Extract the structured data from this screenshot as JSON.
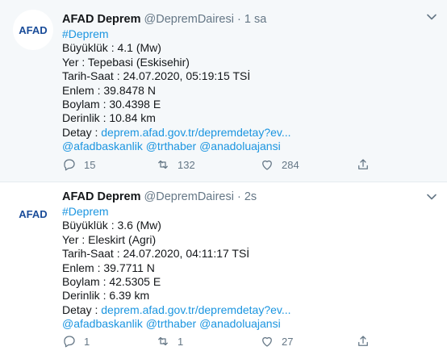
{
  "tweets": [
    {
      "logo_main": "AFAD",
      "author": "AFAD Deprem",
      "handle": "@DepremDairesi",
      "separator": "·",
      "time": "1 sa",
      "hashtag": "#Deprem",
      "magnitude": "Büyüklük : 4.1 (Mw)",
      "place": "Yer : Tepebasi (Eskisehir)",
      "datetime": "Tarih-Saat : 24.07.2020, 05:19:15 TSİ",
      "lat": "Enlem : 39.8478 N",
      "lon": "Boylam : 30.4398 E",
      "depth": "Derinlik : 10.84 km",
      "detail_label": "Detay : ",
      "detail_link": "deprem.afad.gov.tr/depremdetay?ev...",
      "mentions": [
        "@afadbaskanlik",
        "@trthaber",
        "@anadoluajansi"
      ],
      "replies": "15",
      "retweets": "132",
      "likes": "284"
    },
    {
      "logo_main": "AFAD",
      "author": "AFAD Deprem",
      "handle": "@DepremDairesi",
      "separator": "·",
      "time": "2s",
      "hashtag": "#Deprem",
      "magnitude": "Büyüklük : 3.6 (Mw)",
      "place": "Yer : Eleskirt (Agri)",
      "datetime": "Tarih-Saat : 24.07.2020, 04:11:17 TSİ",
      "lat": "Enlem : 39.7711 N",
      "lon": "Boylam : 42.5305 E",
      "depth": "Derinlik : 6.39 km",
      "detail_label": "Detay : ",
      "detail_link": "deprem.afad.gov.tr/depremdetay?ev...",
      "mentions": [
        "@afadbaskanlik",
        "@trthaber",
        "@anadoluajansi"
      ],
      "replies": "1",
      "retweets": "1",
      "likes": "27"
    }
  ],
  "colors": {
    "link": "#1b95e0",
    "muted": "#657786",
    "logo_blue": "#1a4c99",
    "logo_red": "#d8282f"
  },
  "icons": [
    "reply-icon",
    "retweet-icon",
    "like-icon",
    "share-icon",
    "chevron-down-icon"
  ]
}
